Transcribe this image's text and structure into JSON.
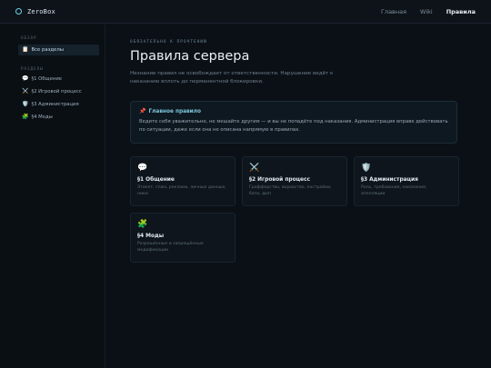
{
  "header": {
    "logo_text": "ZeroBox",
    "nav": [
      {
        "label": "Главная",
        "active": false
      },
      {
        "label": "Wiki",
        "active": false
      },
      {
        "label": "Правила",
        "active": true
      }
    ]
  },
  "sidebar": {
    "overview_heading": "Обзор",
    "active_item": {
      "icon": "📋",
      "label": "Все разделы"
    },
    "sections_heading": "Разделы",
    "items": [
      {
        "icon": "💬",
        "label": "§1 Общение"
      },
      {
        "icon": "⚔️",
        "label": "§2 Игровой процесс"
      },
      {
        "icon": "🛡️",
        "label": "§3 Администрация"
      },
      {
        "icon": "🧩",
        "label": "§4 Моды"
      }
    ]
  },
  "main": {
    "eyebrow": "Обязательно к прочтению",
    "title": "Правила сервера",
    "lead": "Незнание правил не освобождает от ответственности. Нарушение ведёт к наказанию вплоть до перманентной блокировки.",
    "callout": {
      "icon": "📌",
      "title": "Главное правило",
      "text": "Ведите себя уважительно, не мешайте другим — и вы не попадёте под наказания. Администрация вправе действовать по ситуации, даже если она не описана напрямую в правилах."
    },
    "cards": [
      {
        "icon": "💬",
        "title": "§1 Общение",
        "desc": "Этикет, спам, реклама, личные данные, ники"
      },
      {
        "icon": "⚔️",
        "title": "§2 Игровой процесс",
        "desc": "Грифферство, воровство, постройки, баги, дюп"
      },
      {
        "icon": "🛡️",
        "title": "§3 Администрация",
        "desc": "Роль, требования, наказания, апелляции"
      },
      {
        "icon": "🧩",
        "title": "§4 Моды",
        "desc": "Разрешённые и запрещённые модификации"
      }
    ]
  }
}
